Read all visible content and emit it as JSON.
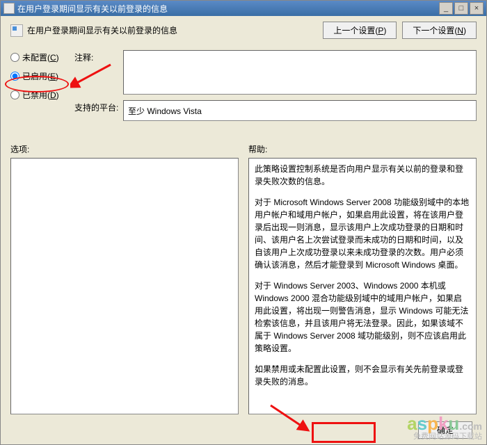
{
  "titlebar": {
    "text": "在用户登录期间显示有关以前登录的信息"
  },
  "header": {
    "setting_name": "在用户登录期间显示有关以前登录的信息",
    "prev_btn": "上一个设置(",
    "prev_key": "P",
    "next_btn": "下一个设置(",
    "next_key": "N"
  },
  "radios": {
    "not_configured": "未配置(",
    "not_configured_key": "C",
    "enabled": "已启用(",
    "enabled_key": "E",
    "disabled": "已禁用(",
    "disabled_key": "D"
  },
  "form": {
    "comment_label": "注释:",
    "platform_label": "支持的平台:",
    "platform_value": "至少 Windows Vista"
  },
  "lower": {
    "options_label": "选项:",
    "help_label": "帮助:",
    "help_paragraphs": [
      "此策略设置控制系统是否向用户显示有关以前的登录和登录失败次数的信息。",
      "对于 Microsoft Windows Server 2008 功能级别域中的本地用户帐户和域用户帐户，如果启用此设置，将在该用户登录后出现一则消息，显示该用户上次成功登录的日期和时间、该用户名上次尝试登录而未成功的日期和时间，以及自该用户上次成功登录以来未成功登录的次数。用户必须确认该消息，然后才能登录到 Microsoft Windows 桌面。",
      "对于 Windows Server 2003、Windows 2000 本机或 Windows 2000 混合功能级别域中的域用户帐户，如果启用此设置，将出现一则警告消息，显示 Windows 可能无法检索该信息，并且该用户将无法登录。因此，如果该域不属于 Windows Server 2008 域功能级别，则不应该启用此策略设置。",
      "如果禁用或未配置此设置，则不会显示有关先前登录或登录失败的消息。"
    ]
  },
  "buttons": {
    "ok": "确定"
  },
  "watermark": {
    "tag": ".com",
    "sub": "免费网站源码下载站"
  }
}
